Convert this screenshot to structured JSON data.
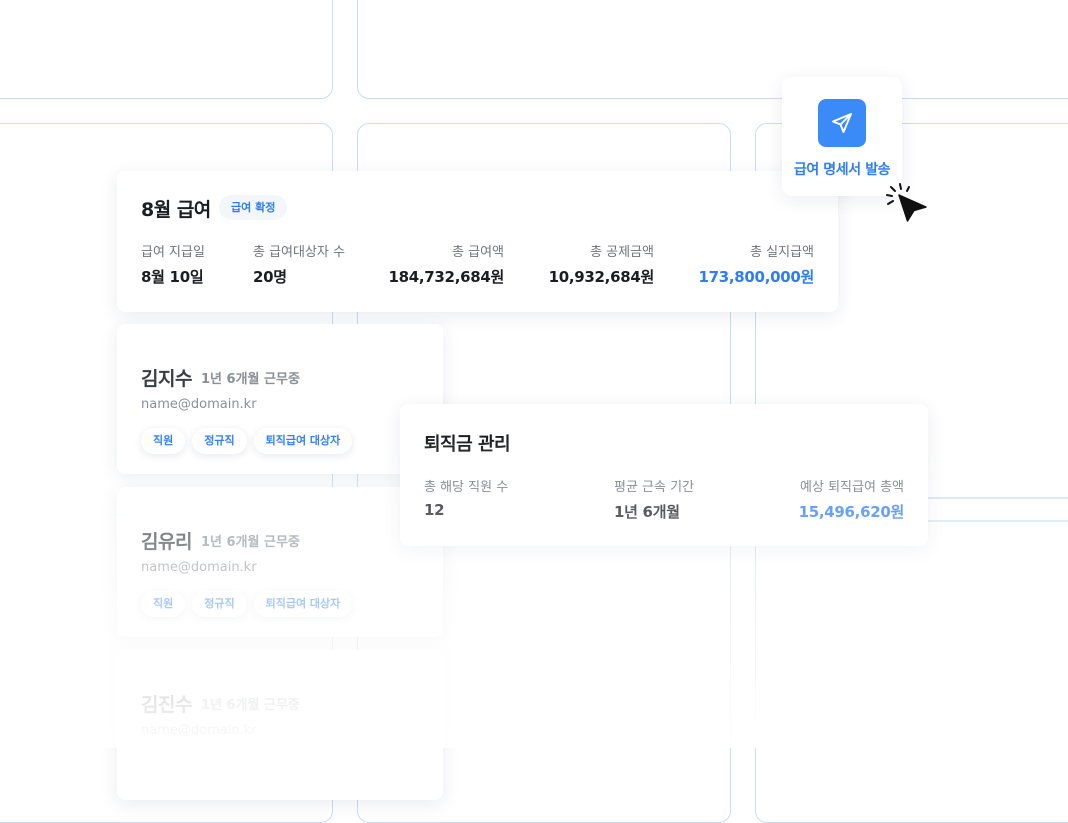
{
  "payroll": {
    "title": "8월 급여",
    "badge": "급여 확정",
    "stats": [
      {
        "label": "급여 지급일",
        "value": "8월 10일"
      },
      {
        "label": "총 급여대상자 수",
        "value": "20명"
      },
      {
        "label": "총 급여액",
        "value": "184,732,684원"
      },
      {
        "label": "총 공제금액",
        "value": "10,932,684원"
      },
      {
        "label": "총 실지급액",
        "value": "173,800,000원"
      }
    ]
  },
  "employees": [
    {
      "name": "김지수",
      "tenure": "1년 6개월 근무중",
      "email": "name@domain.kr",
      "tags": [
        "직원",
        "정규직",
        "퇴직급여 대상자"
      ]
    },
    {
      "name": "김유리",
      "tenure": "1년 6개월 근무중",
      "email": "name@domain.kr",
      "tags": [
        "직원",
        "정규직",
        "퇴직급여 대상자"
      ]
    },
    {
      "name": "김진수",
      "tenure": "1년 6개월 근무중",
      "email": "name@domain.kr",
      "tags": []
    }
  ],
  "severance": {
    "title": "퇴직금 관리",
    "stats": [
      {
        "label": "총 해당 직원 수",
        "value": "12"
      },
      {
        "label": "평균 근속 기간",
        "value": "1년 6개월"
      },
      {
        "label": "예상 퇴직급여 총액",
        "value": "15,496,620원"
      }
    ]
  },
  "send_popup": {
    "label": "급여 명세서 발송",
    "icon": "paper-plane-icon"
  },
  "colors": {
    "accent": "#2f7df6",
    "grid": "#c9ddf8"
  }
}
